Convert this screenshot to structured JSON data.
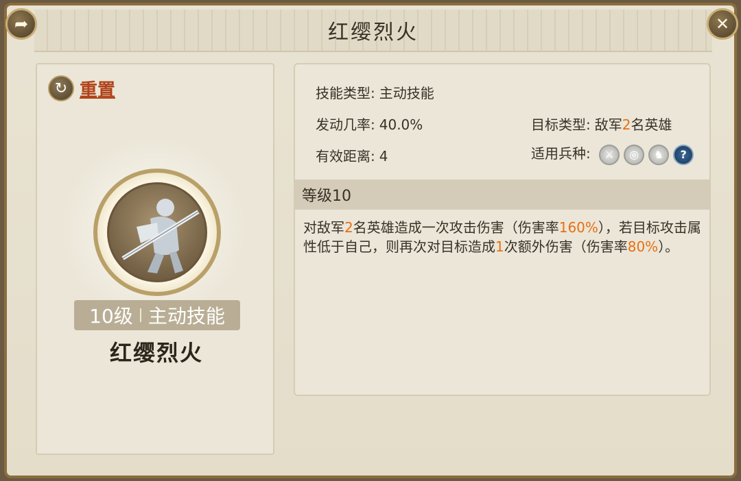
{
  "header": {
    "title": "红缨烈火"
  },
  "left": {
    "reset_label": "重置",
    "level": "10级",
    "skill_type": "主动技能",
    "skill_name": "红缨烈火"
  },
  "info": {
    "skill_type_label": "技能类型:",
    "skill_type_value": "主动技能",
    "trigger_label": "发动几率:",
    "trigger_value": "40.0%",
    "range_label": "有效距离:",
    "range_value": "4",
    "target_label": "目标类型:",
    "target_pre": "敌军",
    "target_num": "2",
    "target_post": "名英雄",
    "troops_label": "适用兵种:",
    "troop_icons": [
      "sword-troop-icon",
      "archer-troop-icon",
      "cavalry-troop-icon",
      "unknown-troop-icon"
    ]
  },
  "level_bar": "等级10",
  "description": {
    "p1": "对敌军",
    "n1": "2",
    "p2": "名英雄造成一次攻击伤害（伤害率",
    "n2": "160%",
    "p3": "），若目标攻击属性低于自己，则再次对目标造成",
    "n3": "1",
    "p4": "次额外伤害（伤害率",
    "n4": "80%",
    "p5": "）。"
  },
  "colors": {
    "highlight": "#e86f14",
    "reset_link": "#b0431a",
    "frame": "#8a6d3f"
  }
}
